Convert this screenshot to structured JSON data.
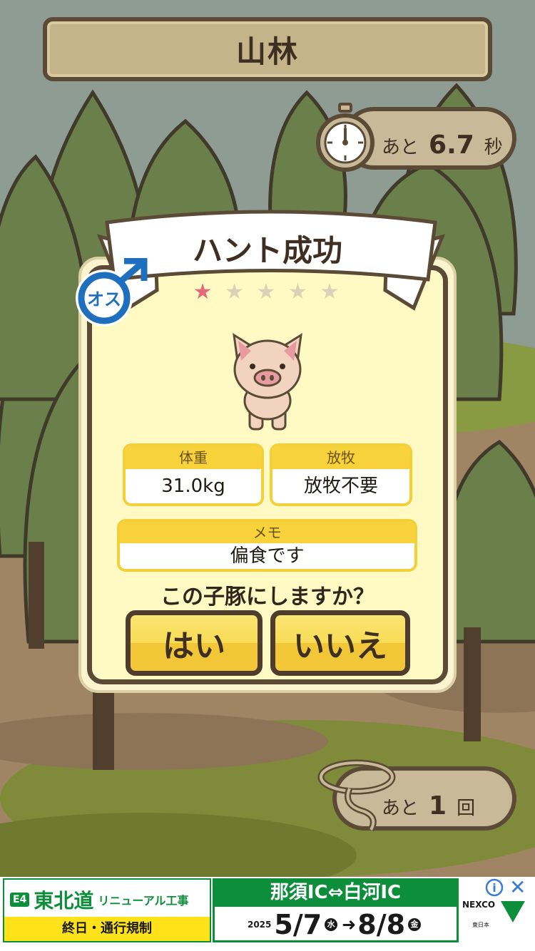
{
  "header": {
    "area_name": "山林"
  },
  "timer": {
    "prefix": "あと",
    "seconds": "6.7",
    "unit": "秒"
  },
  "result": {
    "title": "ハント成功",
    "gender_label": "オス",
    "stars": [
      "★",
      "★",
      "★",
      "★",
      "★"
    ],
    "stars_filled": 1,
    "weight": {
      "label": "体重",
      "value": "31.0kg"
    },
    "grazing": {
      "label": "放牧",
      "value": "放牧不要"
    },
    "memo": {
      "label": "メモ",
      "value": "偏食です"
    },
    "question": "この子豚にしますか？",
    "yes_label": "はい",
    "no_label": "いいえ"
  },
  "tries": {
    "prefix": "あと",
    "count": "1",
    "unit": "回"
  },
  "ad": {
    "route_badge": "E4",
    "road_name": "東北道",
    "work_label": "リニューアル工事",
    "restriction": "終日・通行規制",
    "section": "那須IC⇔白河IC",
    "year": "2025",
    "start_date": "5/7",
    "start_day": "水",
    "end_date": "8/8",
    "end_day": "金",
    "sponsor": "NEXCO",
    "sponsor_sub": "東日本",
    "close_label": "✕",
    "info_label": "i"
  },
  "colors": {
    "wood_dark": "#5b4a36",
    "panel": "#fff9c4",
    "accent_yellow": "#f7d23b",
    "male_blue": "#1f6fbf",
    "nexco_green": "#0c8e3a"
  }
}
